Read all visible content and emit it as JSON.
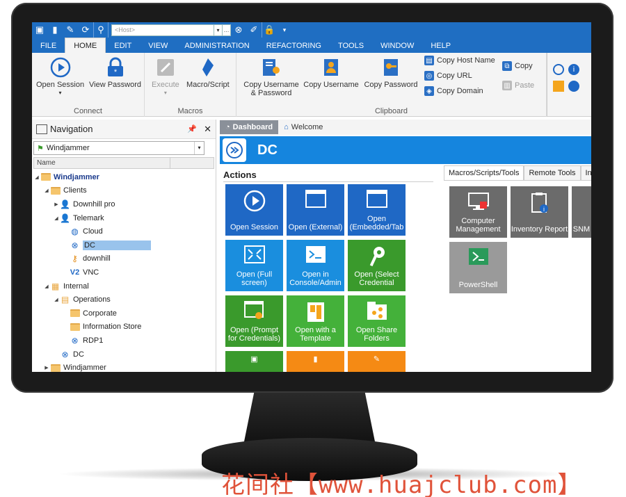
{
  "qat": {
    "host_placeholder": "<Host>"
  },
  "menu": {
    "tabs": [
      "FILE",
      "HOME",
      "EDIT",
      "VIEW",
      "ADMINISTRATION",
      "REFACTORING",
      "TOOLS",
      "WINDOW",
      "HELP"
    ]
  },
  "ribbon": {
    "connect": {
      "label": "Connect",
      "open_session": "Open Session",
      "view_password": "View Password"
    },
    "macros": {
      "label": "Macros",
      "execute": "Execute",
      "macro_script": "Macro/Script"
    },
    "clipboard": {
      "label": "Clipboard",
      "copy_username_password": "Copy Username & Password",
      "copy_username": "Copy Username",
      "copy_password": "Copy Password",
      "copy_host_name": "Copy Host Name",
      "copy_url": "Copy URL",
      "copy_domain": "Copy Domain",
      "copy": "Copy",
      "paste": "Paste"
    }
  },
  "navigation": {
    "title": "Navigation",
    "selected_vault": "Windjammer",
    "column_name": "Name",
    "tree": [
      {
        "label": "Windjammer",
        "icon": "folder-icon",
        "level": 0,
        "exp": "open",
        "bold": true
      },
      {
        "label": "Clients",
        "icon": "folder-icon",
        "level": 1,
        "exp": "open"
      },
      {
        "label": "Downhill pro",
        "icon": "user-icon",
        "level": 2,
        "exp": "closed"
      },
      {
        "label": "Telemark",
        "icon": "user-icon",
        "level": 2,
        "exp": "open"
      },
      {
        "label": "Cloud",
        "icon": "globe-icon",
        "level": 3
      },
      {
        "label": "DC",
        "icon": "rdp-icon",
        "level": 3,
        "selected": true
      },
      {
        "label": "downhill",
        "icon": "key-icon",
        "level": 3
      },
      {
        "label": "VNC",
        "icon": "vnc-icon",
        "level": 3
      },
      {
        "label": "Internal",
        "icon": "building-icon",
        "level": 1,
        "exp": "open"
      },
      {
        "label": "Operations",
        "icon": "briefcase-icon",
        "level": 2,
        "exp": "open"
      },
      {
        "label": "Corporate",
        "icon": "folder-icon",
        "level": 3
      },
      {
        "label": "Information Store",
        "icon": "folder-icon",
        "level": 3
      },
      {
        "label": "RDP1",
        "icon": "rdp-icon",
        "level": 3
      },
      {
        "label": "DC",
        "icon": "rdp-icon",
        "level": 2
      },
      {
        "label": "Windjammer",
        "icon": "folder-icon",
        "level": 1,
        "exp": "closed"
      }
    ]
  },
  "doc_tabs": {
    "dashboard": "Dashboard",
    "welcome": "Welcome"
  },
  "entry": {
    "title": "DC"
  },
  "actions": {
    "title": "Actions",
    "tiles": [
      {
        "label": "Open Session",
        "icon": "play-icon",
        "color": "#1f68c5"
      },
      {
        "label": "Open (External)",
        "icon": "window-icon",
        "color": "#1f68c5"
      },
      {
        "label": "Open (Embedded/Tab",
        "icon": "window-icon",
        "color": "#1f68c5"
      },
      {
        "label": "Open (Full screen)",
        "icon": "fullscreen-icon",
        "color": "#1a8ede"
      },
      {
        "label": "Open in Console/Admin",
        "icon": "console-icon",
        "color": "#1a8ede"
      },
      {
        "label": "Open (Select Credential",
        "icon": "key-icon",
        "color": "#3a9a2c"
      },
      {
        "label": "Open (Prompt for Credentials)",
        "icon": "prompt-icon",
        "color": "#3a9a2c"
      },
      {
        "label": "Open with a Template",
        "icon": "template-icon",
        "color": "#44b13a"
      },
      {
        "label": "Open Share Folders",
        "icon": "share-icon",
        "color": "#44b13a"
      }
    ]
  },
  "right_panel": {
    "tabs": [
      "Macros/Scripts/Tools",
      "Remote Tools",
      "Infor"
    ],
    "tiles": [
      {
        "label": "Computer Management",
        "icon": "computer-icon"
      },
      {
        "label": "Inventory Report",
        "icon": "report-icon"
      },
      {
        "label": "SNM",
        "icon": "snmp-icon"
      },
      {
        "label": "PowerShell",
        "icon": "powershell-icon"
      }
    ]
  },
  "watermark": "花间社【www.huajclub.com】"
}
